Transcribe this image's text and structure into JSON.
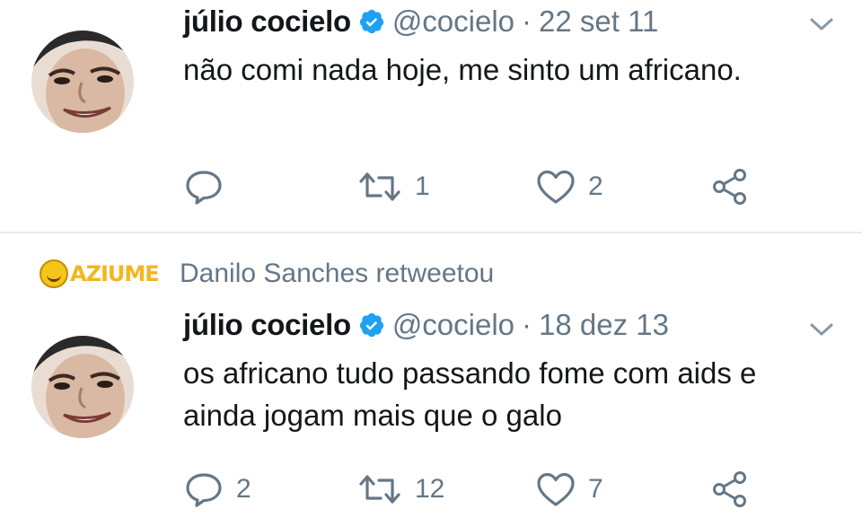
{
  "tweets": [
    {
      "author_name": "júlio cocielo",
      "handle": "@cocielo",
      "separator": "·",
      "date": "22 set 11",
      "text": "não comi nada hoje, me sinto um africano.",
      "replies": "",
      "retweets": "1",
      "likes": "2"
    },
    {
      "retweeted_by": "Danilo Sanches retweetou",
      "watermark": "AZIUME",
      "author_name": "júlio cocielo",
      "handle": "@cocielo",
      "separator": "·",
      "date": "18 dez 13",
      "text": "os africano tudo passando fome com aids e ainda jogam mais que o galo",
      "replies": "2",
      "retweets": "12",
      "likes": "7"
    }
  ],
  "icons": {
    "verified": "verified-badge-icon",
    "chevron": "chevron-down-icon",
    "reply": "reply-icon",
    "retweet": "retweet-icon",
    "like": "heart-icon",
    "share": "share-icon"
  },
  "colors": {
    "verified_blue": "#1da1f2",
    "text": "#14171a",
    "secondary": "#657786",
    "divider": "#e6ecf0"
  }
}
